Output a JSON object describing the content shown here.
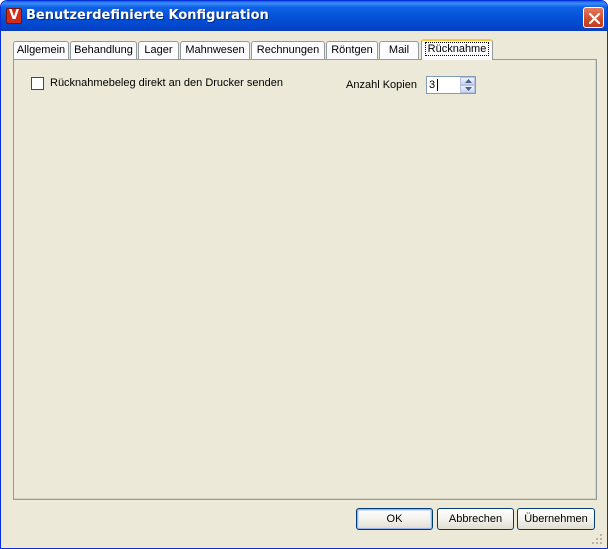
{
  "window": {
    "title": "Benutzerdefinierte Konfiguration",
    "icon": "app-logo-v",
    "icon_letter": "V",
    "accent": "#0351d6",
    "close_color": "#d04a2a"
  },
  "tabs": [
    {
      "label": "Allgemein",
      "active": false
    },
    {
      "label": "Behandlung",
      "active": false
    },
    {
      "label": "Lager",
      "active": false
    },
    {
      "label": "Mahnwesen",
      "active": false
    },
    {
      "label": "Rechnungen",
      "active": false
    },
    {
      "label": "Röntgen",
      "active": false
    },
    {
      "label": "Mail",
      "active": false
    },
    {
      "label": "Rücknahme",
      "active": true
    }
  ],
  "settings": {
    "print_checkbox_label": "Rücknahmebeleg direkt an den  Drucker senden",
    "print_checkbox_checked": false,
    "copies_label": "Anzahl Kopien",
    "copies_value": "3"
  },
  "buttons": {
    "ok": "OK",
    "cancel": "Abbrechen",
    "apply": "Übernehmen"
  }
}
